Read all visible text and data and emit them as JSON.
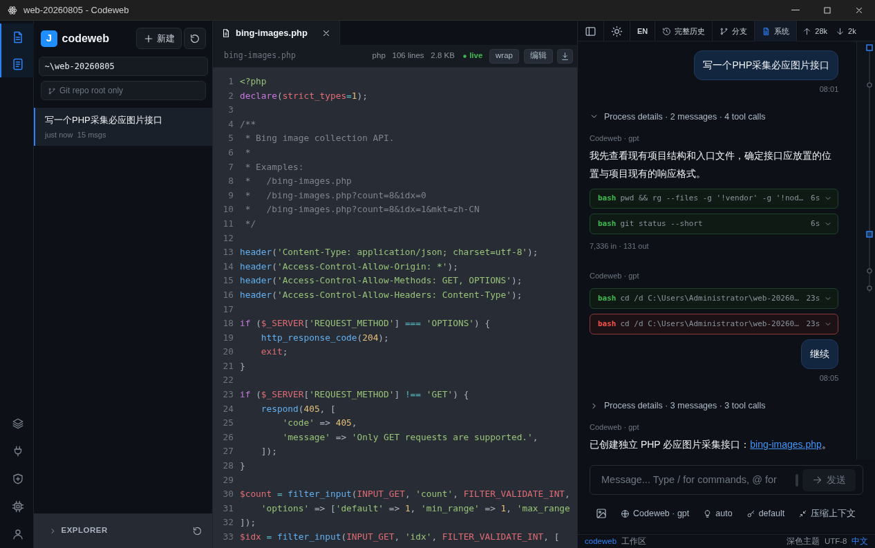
{
  "window": {
    "title": "web-20260805 - Codeweb"
  },
  "activity_bar": {
    "top": [
      {
        "selected": true
      },
      {
        "selected": true
      }
    ],
    "bottom": [
      {
        "selected": false
      },
      {
        "selected": false
      },
      {
        "selected": false
      },
      {
        "selected": false
      },
      {
        "selected": false
      }
    ]
  },
  "sidebar": {
    "logo": "J",
    "app_name": "codeweb",
    "new_button": "新建",
    "path": "~\\web-20260805",
    "git_placeholder": "Git repo root only",
    "sessions": [
      {
        "title": "写一个PHP采集必应图片接口",
        "time": "just now",
        "count": "15 msgs",
        "selected": true
      }
    ],
    "explorer": {
      "label": "EXPLORER",
      "expanded": false
    }
  },
  "editor": {
    "tabs": [
      {
        "label": "bing-images.php",
        "selected": true
      }
    ],
    "file_info": {
      "path": "bing-images.php",
      "language": "php",
      "lines": "106 lines",
      "size": "2.8 KB",
      "status": "live"
    },
    "buttons": [
      "wrap",
      "编辑"
    ],
    "lines": [
      {
        "n": "1",
        "tokens": [
          {
            "kind": "tag",
            "text": "<?php"
          }
        ]
      },
      {
        "n": "2",
        "tokens": [
          {
            "kind": "kw",
            "text": "declare"
          },
          {
            "kind": "p",
            "text": "("
          },
          {
            "kind": "var",
            "text": "strict_types"
          },
          {
            "kind": "op",
            "text": "="
          },
          {
            "kind": "num",
            "text": "1"
          },
          {
            "kind": "p",
            "text": ");"
          }
        ]
      },
      {
        "n": "3"
      },
      {
        "n": "4",
        "tokens": [
          {
            "kind": "cm",
            "text": "/**"
          }
        ]
      },
      {
        "n": "5",
        "tokens": [
          {
            "kind": "cm",
            "text": " * Bing image collection API."
          }
        ]
      },
      {
        "n": "6",
        "tokens": [
          {
            "kind": "cm",
            "text": " *"
          }
        ]
      },
      {
        "n": "7",
        "tokens": [
          {
            "kind": "cm",
            "text": " * Examples:"
          }
        ]
      },
      {
        "n": "8",
        "tokens": [
          {
            "kind": "cm",
            "text": " *   /bing-images.php"
          }
        ]
      },
      {
        "n": "9",
        "tokens": [
          {
            "kind": "cm",
            "text": " *   /bing-images.php?count=8&idx=0"
          }
        ]
      },
      {
        "n": "10",
        "tokens": [
          {
            "kind": "cm",
            "text": " *   /bing-images.php?count=8&idx=1&mkt=zh-CN"
          }
        ]
      },
      {
        "n": "11",
        "tokens": [
          {
            "kind": "cm",
            "text": " */"
          }
        ]
      },
      {
        "n": "12"
      },
      {
        "n": "13",
        "tokens": [
          {
            "kind": "fn",
            "text": "header"
          },
          {
            "kind": "p",
            "text": "("
          },
          {
            "kind": "str",
            "text": "'Content-Type: application/json; charset=utf-8'"
          },
          {
            "kind": "p",
            "text": ");"
          }
        ]
      },
      {
        "n": "14",
        "tokens": [
          {
            "kind": "fn",
            "text": "header"
          },
          {
            "kind": "p",
            "text": "("
          },
          {
            "kind": "str",
            "text": "'Access-Control-Allow-Origin: *'"
          },
          {
            "kind": "p",
            "text": ");"
          }
        ]
      },
      {
        "n": "15",
        "tokens": [
          {
            "kind": "fn",
            "text": "header"
          },
          {
            "kind": "p",
            "text": "("
          },
          {
            "kind": "str",
            "text": "'Access-Control-Allow-Methods: GET, OPTIONS'"
          },
          {
            "kind": "p",
            "text": ");"
          }
        ]
      },
      {
        "n": "16",
        "tokens": [
          {
            "kind": "fn",
            "text": "header"
          },
          {
            "kind": "p",
            "text": "("
          },
          {
            "kind": "str",
            "text": "'Access-Control-Allow-Headers: Content-Type'"
          },
          {
            "kind": "p",
            "text": ");"
          }
        ]
      },
      {
        "n": "17"
      },
      {
        "n": "18",
        "tokens": [
          {
            "kind": "kw",
            "text": "if"
          },
          {
            "kind": "p",
            "text": " ("
          },
          {
            "kind": "var",
            "text": "$_SERVER"
          },
          {
            "kind": "p",
            "text": "["
          },
          {
            "kind": "str",
            "text": "'REQUEST_METHOD'"
          },
          {
            "kind": "p",
            "text": "] "
          },
          {
            "kind": "op",
            "text": "==="
          },
          {
            "kind": "str",
            "text": " 'OPTIONS'"
          },
          {
            "kind": "p",
            "text": ") {"
          }
        ]
      },
      {
        "n": "19",
        "tokens": [
          {
            "kind": "fn",
            "text": "    http_response_code"
          },
          {
            "kind": "p",
            "text": "("
          },
          {
            "kind": "num",
            "text": "204"
          },
          {
            "kind": "p",
            "text": ");"
          }
        ]
      },
      {
        "n": "20",
        "tokens": [
          {
            "kind": "var",
            "text": "    exit"
          },
          {
            "kind": "p",
            "text": ";"
          }
        ]
      },
      {
        "n": "21",
        "tokens": [
          {
            "kind": "p",
            "text": "}"
          }
        ]
      },
      {
        "n": "22"
      },
      {
        "n": "23",
        "tokens": [
          {
            "kind": "kw",
            "text": "if"
          },
          {
            "kind": "p",
            "text": " ("
          },
          {
            "kind": "var",
            "text": "$_SERVER"
          },
          {
            "kind": "p",
            "text": "["
          },
          {
            "kind": "str",
            "text": "'REQUEST_METHOD'"
          },
          {
            "kind": "p",
            "text": "] "
          },
          {
            "kind": "op",
            "text": "!=="
          },
          {
            "kind": "str",
            "text": " 'GET'"
          },
          {
            "kind": "p",
            "text": ") {"
          }
        ]
      },
      {
        "n": "24",
        "tokens": [
          {
            "kind": "fn",
            "text": "    respond"
          },
          {
            "kind": "p",
            "text": "("
          },
          {
            "kind": "num",
            "text": "405"
          },
          {
            "kind": "p",
            "text": ", ["
          }
        ]
      },
      {
        "n": "25",
        "tokens": [
          {
            "kind": "str",
            "text": "        'code'"
          },
          {
            "kind": "p",
            "text": " => "
          },
          {
            "kind": "num",
            "text": "405"
          },
          {
            "kind": "p",
            "text": ","
          }
        ]
      },
      {
        "n": "26",
        "tokens": [
          {
            "kind": "str",
            "text": "        'message'"
          },
          {
            "kind": "p",
            "text": " => "
          },
          {
            "kind": "str",
            "text": "'Only GET requests are supported.'"
          },
          {
            "kind": "p",
            "text": ","
          }
        ]
      },
      {
        "n": "27",
        "tokens": [
          {
            "kind": "p",
            "text": "    ]);"
          }
        ]
      },
      {
        "n": "28",
        "tokens": [
          {
            "kind": "p",
            "text": "}"
          }
        ]
      },
      {
        "n": "29"
      },
      {
        "n": "30",
        "tokens": [
          {
            "kind": "var",
            "text": "$count"
          },
          {
            "kind": "op",
            "text": " = "
          },
          {
            "kind": "fn",
            "text": "filter_input"
          },
          {
            "kind": "p",
            "text": "("
          },
          {
            "kind": "var",
            "text": "INPUT_GET"
          },
          {
            "kind": "p",
            "text": ", "
          },
          {
            "kind": "str",
            "text": "'count'"
          },
          {
            "kind": "p",
            "text": ", "
          },
          {
            "kind": "var",
            "text": "FILTER_VALIDATE_INT"
          },
          {
            "kind": "p",
            "text": ","
          }
        ]
      },
      {
        "n": "31",
        "tokens": [
          {
            "kind": "str",
            "text": "    'options'"
          },
          {
            "kind": "p",
            "text": " => ["
          },
          {
            "kind": "str",
            "text": "'default'"
          },
          {
            "kind": "p",
            "text": " => "
          },
          {
            "kind": "num",
            "text": "1"
          },
          {
            "kind": "p",
            "text": ", "
          },
          {
            "kind": "str",
            "text": "'min_range'"
          },
          {
            "kind": "p",
            "text": " => "
          },
          {
            "kind": "num",
            "text": "1"
          },
          {
            "kind": "p",
            "text": ", "
          },
          {
            "kind": "str",
            "text": "'max_range"
          }
        ]
      },
      {
        "n": "32",
        "tokens": [
          {
            "kind": "p",
            "text": "]);"
          }
        ]
      },
      {
        "n": "33",
        "tokens": [
          {
            "kind": "var",
            "text": "$idx"
          },
          {
            "kind": "op",
            "text": " = "
          },
          {
            "kind": "fn",
            "text": "filter_input"
          },
          {
            "kind": "p",
            "text": "("
          },
          {
            "kind": "var",
            "text": "INPUT_GET"
          },
          {
            "kind": "p",
            "text": ", "
          },
          {
            "kind": "str",
            "text": "'idx'"
          },
          {
            "kind": "p",
            "text": ", "
          },
          {
            "kind": "var",
            "text": "FILTER_VALIDATE_INT"
          },
          {
            "kind": "p",
            "text": ", ["
          }
        ]
      }
    ]
  },
  "chat": {
    "toolbar": [
      {
        "selected": false
      },
      {
        "selected": false
      },
      {
        "label": "EN",
        "selected": false
      },
      {
        "label": "完整历史",
        "selected": false
      },
      {
        "label": "分支",
        "selected": false
      },
      {
        "label": "系统",
        "selected": true
      },
      {
        "label": "28k",
        "selected": false
      },
      {
        "label": "2k",
        "selected": false
      }
    ],
    "messages": [
      {
        "kind": "user",
        "text": "写一个PHP采集必应图片接口",
        "time": "08:01"
      },
      {
        "kind": "process",
        "expanded": true,
        "label": "Process details · 2 messages · 4 tool calls"
      },
      {
        "kind": "assistant",
        "author": "Codeweb · gpt",
        "text": "我先查看现有项目结构和入口文件，确定接口应放置的位置与项目现有的响应格式。"
      },
      {
        "kind": "tool",
        "failed": false,
        "tool": "bash",
        "command": "pwd && rg --files -g '!vendor' -g '!nod…",
        "duration": "6s"
      },
      {
        "kind": "tool",
        "failed": false,
        "tool": "bash",
        "command": "git status --short",
        "duration": "6s"
      },
      {
        "kind": "usage",
        "text": "7,336 in · 131 out"
      },
      {
        "kind": "assistant",
        "author": "Codeweb · gpt"
      },
      {
        "kind": "tool",
        "failed": false,
        "tool": "bash",
        "command": "cd /d C:\\Users\\Administrator\\web-20260…",
        "duration": "23s"
      },
      {
        "kind": "tool",
        "failed": true,
        "tool": "bash",
        "command": "cd /d C:\\Users\\Administrator\\web-20260…",
        "duration": "23s"
      },
      {
        "kind": "user",
        "text": "继续",
        "time": "08:05"
      },
      {
        "kind": "process",
        "expanded": false,
        "label": "Process details · 3 messages · 3 tool calls"
      },
      {
        "kind": "assistant",
        "author": "Codeweb · gpt",
        "text": "已创建独立 PHP 必应图片采集接口：",
        "link": "bing-images.php",
        "after": "。"
      }
    ],
    "composer": {
      "placeholder": "Message... Type / for commands, @ for",
      "send": "发送"
    },
    "options": [
      "Codeweb · gpt",
      "auto",
      "default",
      "压缩上下文"
    ]
  },
  "status_bar": {
    "left": [
      "codeweb",
      "工作区"
    ],
    "right": [
      "深色主题",
      "UTF-8",
      "中文"
    ]
  }
}
